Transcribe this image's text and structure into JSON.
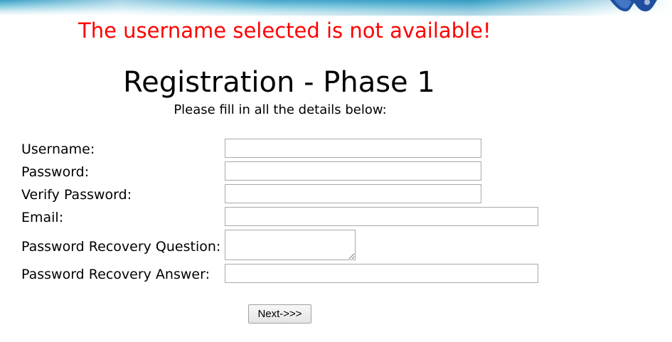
{
  "error": {
    "message": "The username selected is not available!",
    "color": "#ff0000"
  },
  "header": {
    "title": "Registration - Phase 1",
    "subtitle": "Please fill in all the details below:"
  },
  "form": {
    "fields": [
      {
        "label": "Username:",
        "value": ""
      },
      {
        "label": "Password:",
        "value": ""
      },
      {
        "label": "Verify Password:",
        "value": ""
      },
      {
        "label": "Email:",
        "value": ""
      },
      {
        "label": "Password Recovery Question:",
        "value": ""
      },
      {
        "label": "Password Recovery Answer:",
        "value": ""
      }
    ],
    "submit_label": "Next->>>"
  },
  "icons": {
    "banner_logo": "logo-icon"
  }
}
